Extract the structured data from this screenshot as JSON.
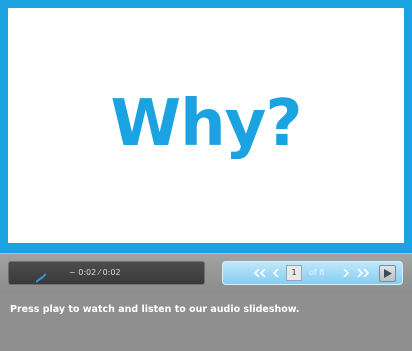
{
  "slide": {
    "title": "Why?"
  },
  "player": {
    "audio_icon": "audio-wave-icon",
    "time_display": "~ 0:02 ⁄ 0:02",
    "navigation": {
      "first_icon": "double-chevron-left-icon",
      "prev_icon": "chevron-left-icon",
      "current_page": "1",
      "page_total": "of 8",
      "next_icon": "chevron-right-icon",
      "last_icon": "double-chevron-right-icon",
      "play_icon": "play-icon"
    }
  },
  "caption": "Press play to watch and listen to our audio slideshow.",
  "colors": {
    "accent_blue": "#1aa3e0",
    "panel_dark": "#3a3a3a",
    "nav_light_blue": "#86cdf1",
    "background_gray": "#8f8f8f"
  }
}
